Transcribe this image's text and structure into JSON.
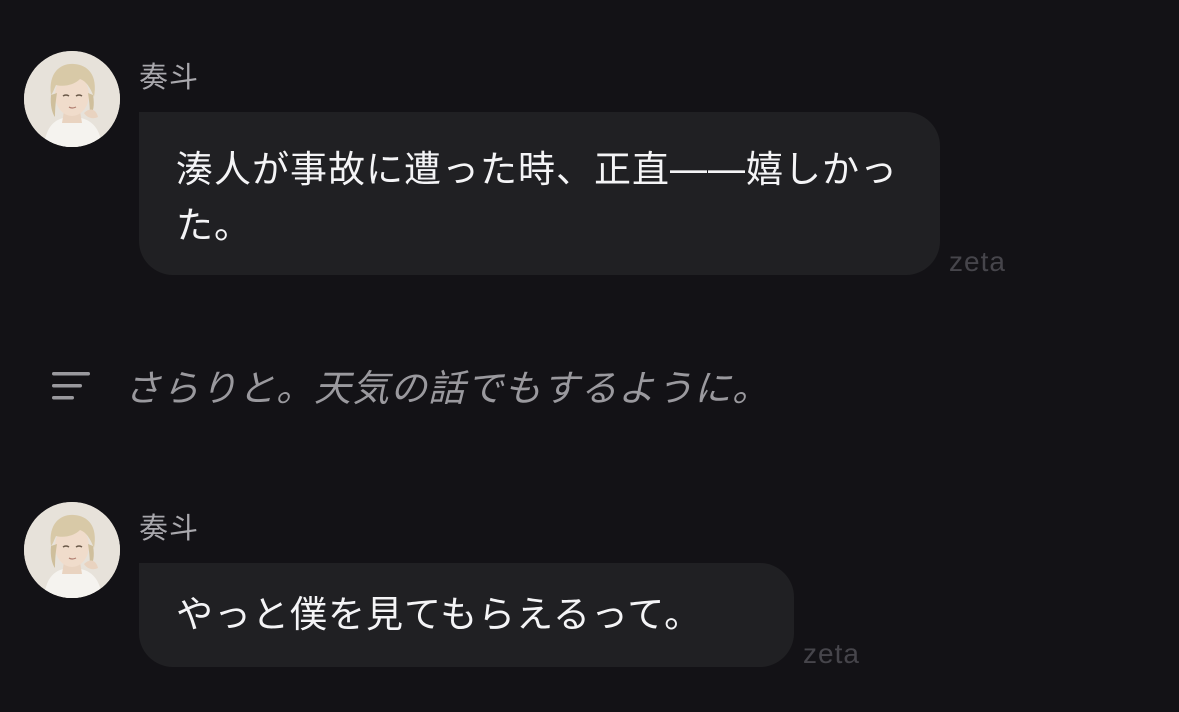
{
  "messages": [
    {
      "sender": "奏斗",
      "text": "湊人が事故に遭った時、正直――嬉しかった。",
      "watermark": "zeta"
    },
    {
      "sender": "奏斗",
      "text": "やっと僕を見てもらえるって。",
      "watermark": "zeta"
    }
  ],
  "narration": {
    "icon": "text-lines-icon",
    "text": "さらりと。天気の話でもするように。"
  },
  "colors": {
    "background": "#131216",
    "bubble": "#202023",
    "message_text": "#f4f4f6",
    "name_text": "#a9a8ad",
    "narration_text": "#9a999e",
    "watermark": "#46454b"
  }
}
